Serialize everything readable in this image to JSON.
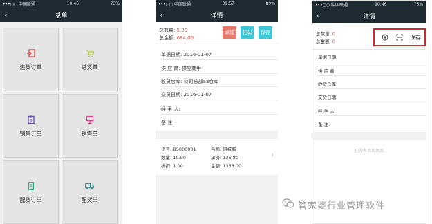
{
  "status_bar": {
    "carrier": "•••○○ 中国联通",
    "battery": "73%",
    "battery_2": "89%"
  },
  "screen1": {
    "time": "10:46",
    "title": "录单",
    "tiles": [
      {
        "label": "进货订单",
        "icon": "inbound-order-icon",
        "color": "#e24a4a"
      },
      {
        "label": "进货单",
        "icon": "shopping-cart-icon",
        "color": "#b5c92a"
      },
      {
        "label": "销售订单",
        "icon": "clipboard-icon",
        "color": "#6a4fb0"
      },
      {
        "label": "销售单",
        "icon": "sales-slip-icon",
        "color": "#d94a8c"
      },
      {
        "label": "配货订单",
        "icon": "phone-document-icon",
        "color": "#2eae8a"
      },
      {
        "label": "配货单",
        "icon": "delivery-truck-icon",
        "color": "#2e9e9e"
      }
    ]
  },
  "screen2": {
    "time": "09:57",
    "title": "详情",
    "total_qty_label": "总数量:",
    "total_qty_value": "5.00",
    "total_amount_label": "总金额:",
    "total_amount_value": "684.00",
    "buttons": {
      "add": "添加",
      "scan": "扫码",
      "save": "保存"
    },
    "button_colors": {
      "add": "#e77a6d",
      "scan": "#3fc7d6",
      "save": "#3fc7d6"
    },
    "form": {
      "bill_date": "单据日期: 2016-01-07",
      "supplier": "供 应 商: 供应商甲",
      "warehouse": "收货仓库: 公司总部aa仓库",
      "delivery_date": "交货日期: 2016-01-07",
      "handler": "经 手 人:",
      "remark": "备      注:"
    },
    "item": {
      "code_label": "货号:",
      "code": "B5006001",
      "name_label": "名称:",
      "name": "短袜胸",
      "qty_label": "数量:",
      "qty": "10.00",
      "price_label": "单价:",
      "price": "136.80",
      "discount_label": "折扣:",
      "discount": "1.00",
      "amount_label": "金额:",
      "amount": "1368.00"
    }
  },
  "screen3": {
    "time": "10:46",
    "title": "详情",
    "total_qty_label": "总数量:",
    "total_qty_value": "0",
    "total_amount_label": "总金额:",
    "total_amount_value": "0",
    "save": "保存",
    "form": {
      "bill_date": "单据日期:",
      "supplier": "供 应 商:",
      "warehouse": "收货仓库:",
      "delivery_date": "交货日期:",
      "handler": "经 手 人:",
      "remark": "备      注:"
    },
    "empty_message": "还没有添加商品",
    "highlight_color": "#d0272b"
  },
  "watermark": {
    "text": "管家婆行业管理软件"
  }
}
